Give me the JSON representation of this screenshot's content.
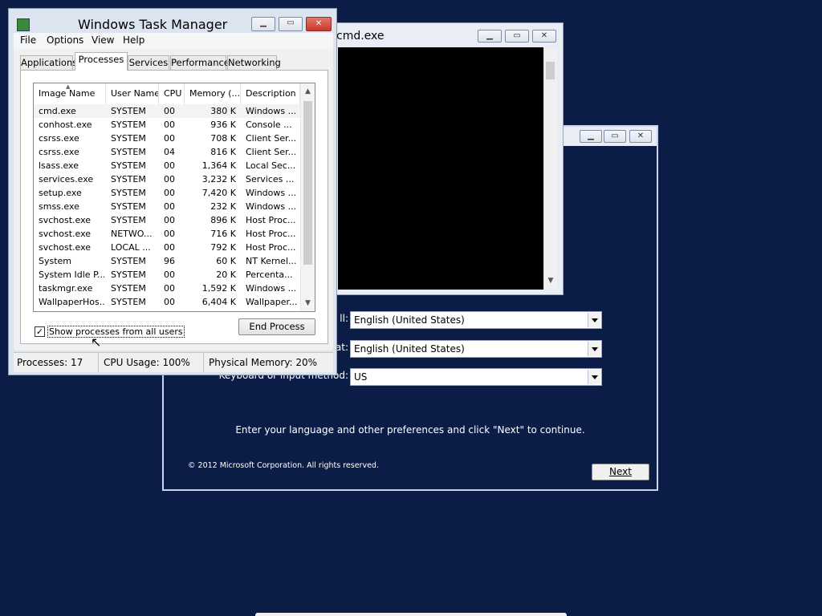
{
  "setup": {
    "fields": [
      {
        "label": "ll:",
        "value": "English (United States)"
      },
      {
        "label": "at:",
        "value": "English (United States)"
      },
      {
        "label": "Keyboard or input method:",
        "value": "US"
      }
    ],
    "instruction": "Enter your language and other preferences and click \"Next\" to continue.",
    "copyright": "© 2012 Microsoft Corporation. All rights reserved.",
    "next_label": "Next"
  },
  "cmd": {
    "title": "cmd.exe"
  },
  "taskmgr": {
    "title": "Windows Task Manager",
    "menu": [
      "File",
      "Options",
      "View",
      "Help"
    ],
    "tabs": [
      "Applications",
      "Processes",
      "Services",
      "Performance",
      "Networking"
    ],
    "active_tab": "Processes",
    "columns": [
      "Image Name",
      "User Name",
      "CPU",
      "Memory (...",
      "Description"
    ],
    "processes": [
      {
        "name": "cmd.exe",
        "user": "SYSTEM",
        "cpu": "00",
        "mem": "380 K",
        "desc": "Windows ..."
      },
      {
        "name": "conhost.exe",
        "user": "SYSTEM",
        "cpu": "00",
        "mem": "936 K",
        "desc": "Console ..."
      },
      {
        "name": "csrss.exe",
        "user": "SYSTEM",
        "cpu": "00",
        "mem": "708 K",
        "desc": "Client Ser..."
      },
      {
        "name": "csrss.exe",
        "user": "SYSTEM",
        "cpu": "04",
        "mem": "816 K",
        "desc": "Client Ser..."
      },
      {
        "name": "lsass.exe",
        "user": "SYSTEM",
        "cpu": "00",
        "mem": "1,364 K",
        "desc": "Local Sec..."
      },
      {
        "name": "services.exe",
        "user": "SYSTEM",
        "cpu": "00",
        "mem": "3,232 K",
        "desc": "Services ..."
      },
      {
        "name": "setup.exe",
        "user": "SYSTEM",
        "cpu": "00",
        "mem": "7,420 K",
        "desc": "Windows ..."
      },
      {
        "name": "smss.exe",
        "user": "SYSTEM",
        "cpu": "00",
        "mem": "232 K",
        "desc": "Windows ..."
      },
      {
        "name": "svchost.exe",
        "user": "SYSTEM",
        "cpu": "00",
        "mem": "896 K",
        "desc": "Host Proc..."
      },
      {
        "name": "svchost.exe",
        "user": "NETWO...",
        "cpu": "00",
        "mem": "716 K",
        "desc": "Host Proc..."
      },
      {
        "name": "svchost.exe",
        "user": "LOCAL ...",
        "cpu": "00",
        "mem": "792 K",
        "desc": "Host Proc..."
      },
      {
        "name": "System",
        "user": "SYSTEM",
        "cpu": "96",
        "mem": "60 K",
        "desc": "NT Kernel..."
      },
      {
        "name": "System Idle P...",
        "user": "SYSTEM",
        "cpu": "00",
        "mem": "20 K",
        "desc": "Percenta..."
      },
      {
        "name": "taskmgr.exe",
        "user": "SYSTEM",
        "cpu": "00",
        "mem": "1,592 K",
        "desc": "Windows ..."
      },
      {
        "name": "WallpaperHos...",
        "user": "SYSTEM",
        "cpu": "00",
        "mem": "6,404 K",
        "desc": "Wallpaper..."
      }
    ],
    "show_all_label": "Show processes from all users",
    "show_all_checked": true,
    "end_process_label": "End Process",
    "status": {
      "processes": "Processes: 17",
      "cpu": "CPU Usage: 100%",
      "memory": "Physical Memory: 20%"
    }
  }
}
